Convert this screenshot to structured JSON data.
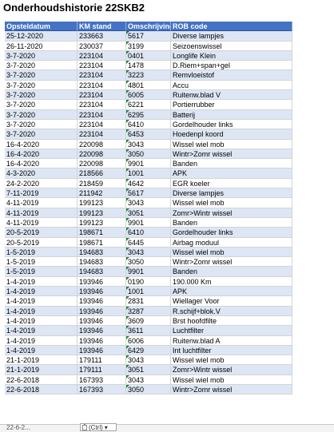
{
  "title": "Onderhoudshistorie 22SKB2",
  "headers": [
    "Opsteldatum",
    "KM stand",
    "Omschrijving",
    "ROB code"
  ],
  "rows": [
    [
      "25-12-2020",
      "233663",
      "5617",
      "Diverse lampjes"
    ],
    [
      "26-11-2020",
      "230037",
      "3199",
      "Seizoenswissel"
    ],
    [
      "3-7-2020",
      "223104",
      "0401",
      "Longlife Klein"
    ],
    [
      "3-7-2020",
      "223104",
      "1478",
      "D.Riem+span+gel"
    ],
    [
      "3-7-2020",
      "223104",
      "3223",
      "Remvloeistof"
    ],
    [
      "3-7-2020",
      "223104",
      "4801",
      "Accu"
    ],
    [
      "3-7-2020",
      "223104",
      "6005",
      "Ruitenw.blad V"
    ],
    [
      "3-7-2020",
      "223104",
      "6221",
      "Portierrubber"
    ],
    [
      "3-7-2020",
      "223104",
      "6295",
      "Batterij"
    ],
    [
      "3-7-2020",
      "223104",
      "6410",
      "Gordelhouder links"
    ],
    [
      "3-7-2020",
      "223104",
      "6453",
      "Hoedenpl koord"
    ],
    [
      "16-4-2020",
      "220098",
      "3043",
      "Wissel wiel mob"
    ],
    [
      "16-4-2020",
      "220098",
      "3050",
      "Wintr>Zomr wissel"
    ],
    [
      "16-4-2020",
      "220098",
      "9901",
      "Banden"
    ],
    [
      "4-3-2020",
      "218566",
      "1001",
      "APK"
    ],
    [
      "24-2-2020",
      "218459",
      "4642",
      "EGR koeler"
    ],
    [
      "7-11-2019",
      "211942",
      "5617",
      "Diverse lampjes"
    ],
    [
      "4-11-2019",
      "199123",
      "3043",
      "Wissel wiel mob"
    ],
    [
      "4-11-2019",
      "199123",
      "3051",
      "Zomr>Wintr wissel"
    ],
    [
      "4-11-2019",
      "199123",
      "9901",
      "Banden"
    ],
    [
      "20-5-2019",
      "198671",
      "6410",
      "Gordelhouder links"
    ],
    [
      "20-5-2019",
      "198671",
      "6445",
      "Airbag moduul"
    ],
    [
      "1-5-2019",
      "194683",
      "3043",
      "Wissel wiel mob"
    ],
    [
      "1-5-2019",
      "194683",
      "3050",
      "Wintr>Zomr wissel"
    ],
    [
      "1-5-2019",
      "194683",
      "9901",
      "Banden"
    ],
    [
      "1-4-2019",
      "193946",
      "0190",
      "190.000 Km"
    ],
    [
      "1-4-2019",
      "193946",
      "1001",
      "APK"
    ],
    [
      "1-4-2019",
      "193946",
      "2831",
      "Wiellager Voor"
    ],
    [
      "1-4-2019",
      "193946",
      "3287",
      "R.schijf+blok.V"
    ],
    [
      "1-4-2019",
      "193946",
      "3609",
      "Brst hoofdfilte"
    ],
    [
      "1-4-2019",
      "193946",
      "3611",
      "Luchtfilter"
    ],
    [
      "1-4-2019",
      "193946",
      "6006",
      "Ruitenw.blad A"
    ],
    [
      "1-4-2019",
      "193946",
      "6429",
      "Int luchtfilter"
    ],
    [
      "21-1-2019",
      "179111",
      "3043",
      "Wissel wiel mob"
    ],
    [
      "21-1-2019",
      "179111",
      "3051",
      "Zomr>Wintr wissel"
    ],
    [
      "22-6-2018",
      "167393",
      "3043",
      "Wissel wiel mob"
    ],
    [
      "22-6-2018",
      "167393",
      "3050",
      "Wintr>Zomr wissel"
    ]
  ],
  "partial_row_text": "22-6-2...",
  "paste_options_label": "(Ctrl)",
  "paste_dropdown_glyph": "▾"
}
